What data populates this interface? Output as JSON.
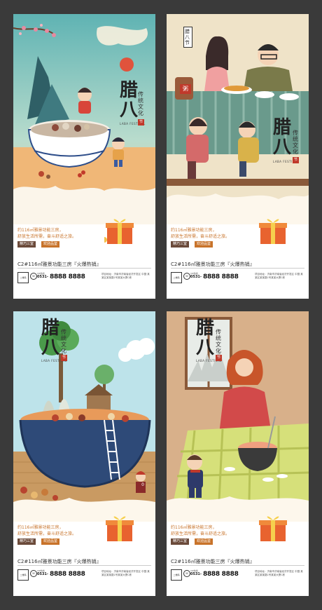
{
  "posters": [
    {
      "title": "腊八",
      "subtitle": "传统文化",
      "english": "LABA FESTIVAL",
      "seal": "节",
      "copy_line1": "约116㎡雅景功能三房，",
      "copy_line2": "舒放生活所需，奋斗舒适之旅。",
      "tag1": "精巧三室",
      "tag2": "欢迎品鉴",
      "headline": "C2#116㎡雅景功能三房『火爆热销』",
      "qr_label": "二维码",
      "phone_label": "VIP热线",
      "phone_prefix": "0531-",
      "phone": "8888 8888",
      "address": "项目地址：济南市济南省经济开发区 中国·某某区某某路1号某某大厦C栋"
    },
    {
      "title": "腊八",
      "subtitle": "传统文化",
      "english": "LABA FESTIVAL",
      "seal": "节",
      "side_label": "腊八节",
      "bowl_label": "粥",
      "copy_line1": "约116㎡雅景功能三房，",
      "copy_line2": "舒放生活所需，奋斗舒适之旅。",
      "tag1": "精巧三室",
      "tag2": "欢迎品鉴",
      "headline": "C2#116㎡雅景功能三房『火爆热销』",
      "qr_label": "二维码",
      "phone_label": "VIP热线",
      "phone_prefix": "0531-",
      "phone": "8888 8888",
      "address": "项目地址：济南市济南省经济开发区 中国·某某区某某路1号某某大厦C栋"
    },
    {
      "title": "腊八",
      "subtitle": "传统文化",
      "english": "LABA FESTIVAL",
      "seal": "节",
      "kid_shirt": "0",
      "copy_line1": "约116㎡雅景功能三房，",
      "copy_line2": "舒放生活所需，奋斗舒适之旅。",
      "tag1": "精巧三室",
      "tag2": "欢迎品鉴",
      "headline": "C2#116㎡雅景功能三房『火爆热销』",
      "qr_label": "二维码",
      "phone_label": "VIP热线",
      "phone_prefix": "0531-",
      "phone": "8888 8888",
      "address": "项目地址：济南市济南省经济开发区 中国·某某区某某路1号某某大厦C栋"
    },
    {
      "title": "腊八",
      "subtitle": "传统文化",
      "english": "LABA FESTIVAL",
      "seal": "节",
      "copy_line1": "约116㎡雅景功能三房，",
      "copy_line2": "舒放生活所需，奋斗舒适之旅。",
      "tag1": "精巧三室",
      "tag2": "欢迎品鉴",
      "headline": "C2#116㎡雅景功能三房『火爆热销』",
      "qr_label": "二维码",
      "phone_label": "VIP热线",
      "phone_prefix": "0531-",
      "phone": "8888 8888",
      "address": "项目地址：济南市济南省经济开发区 中国·某某区某某路1号某某大厦C栋"
    }
  ],
  "colors": {
    "background": "#3a3a3a",
    "accent_orange": "#c8732a",
    "tag_brown": "#6b4a3a",
    "seal_red": "#c0392b"
  }
}
